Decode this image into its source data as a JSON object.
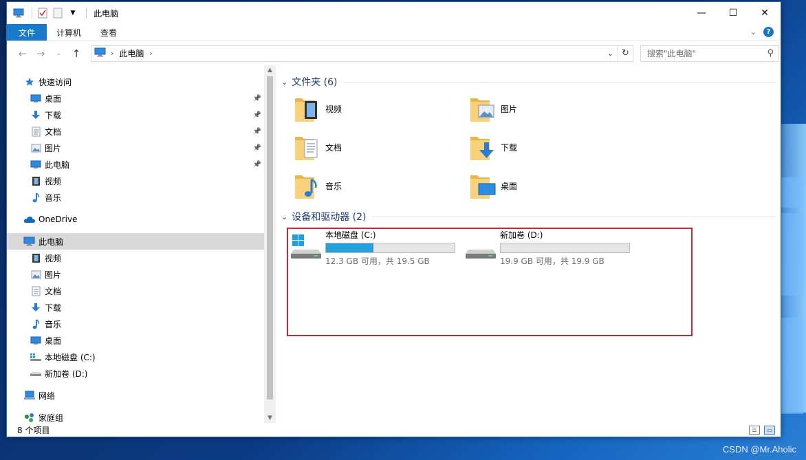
{
  "window": {
    "title": "此电脑"
  },
  "ribbon": {
    "tabs": [
      "文件",
      "计算机",
      "查看"
    ]
  },
  "navbar": {
    "breadcrumb": "此电脑",
    "search_placeholder": "搜索\"此电脑\""
  },
  "sidebar": {
    "quick_access": "快速访问",
    "quick_items": [
      {
        "label": "桌面",
        "icon": "desktop-icon"
      },
      {
        "label": "下载",
        "icon": "download-icon"
      },
      {
        "label": "文档",
        "icon": "document-icon"
      },
      {
        "label": "图片",
        "icon": "picture-icon"
      },
      {
        "label": "此电脑",
        "icon": "computer-icon"
      },
      {
        "label": "视频",
        "icon": "video-icon"
      },
      {
        "label": "音乐",
        "icon": "music-icon"
      }
    ],
    "onedrive": "OneDrive",
    "this_pc": "此电脑",
    "pc_items": [
      {
        "label": "视频",
        "icon": "video-icon"
      },
      {
        "label": "图片",
        "icon": "picture-icon"
      },
      {
        "label": "文档",
        "icon": "document-icon"
      },
      {
        "label": "下载",
        "icon": "download-icon"
      },
      {
        "label": "音乐",
        "icon": "music-icon"
      },
      {
        "label": "桌面",
        "icon": "desktop-icon"
      },
      {
        "label": "本地磁盘 (C:)",
        "icon": "drive-c-icon"
      },
      {
        "label": "新加卷 (D:)",
        "icon": "drive-d-icon"
      }
    ],
    "network": "网络",
    "homegroup": "家庭组"
  },
  "content": {
    "folders_header": "文件夹 (6)",
    "folders": [
      {
        "label": "视频",
        "icon": "video-folder-icon"
      },
      {
        "label": "图片",
        "icon": "picture-folder-icon"
      },
      {
        "label": "文档",
        "icon": "document-folder-icon"
      },
      {
        "label": "下载",
        "icon": "download-folder-icon"
      },
      {
        "label": "音乐",
        "icon": "music-folder-icon"
      },
      {
        "label": "桌面",
        "icon": "desktop-folder-icon"
      }
    ],
    "drives_header": "设备和驱动器 (2)",
    "drives": [
      {
        "label": "本地磁盘 (C:)",
        "info": "12.3 GB 可用，共 19.5 GB",
        "used_fraction": 0.37
      },
      {
        "label": "新加卷 (D:)",
        "info": "19.9 GB 可用，共 19.9 GB",
        "used_fraction": 0.0
      }
    ]
  },
  "status": {
    "item_count": "8 个项目"
  },
  "watermark": "CSDN @Mr.Aholic",
  "colors": {
    "accent": "#1979ca",
    "header_text": "#1e3c78",
    "drive_bar": "#26a0da",
    "highlight": "#d3242c"
  }
}
